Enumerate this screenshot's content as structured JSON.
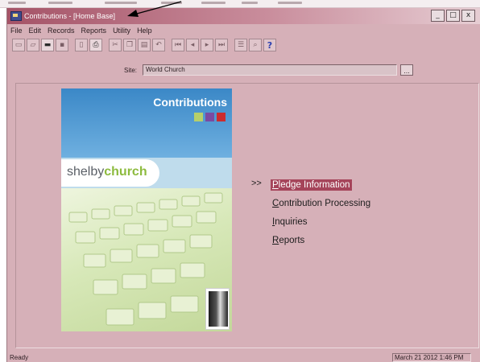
{
  "window": {
    "title": "Contributions - [Home Base]",
    "controls": {
      "minimize": "_",
      "maximize": "□",
      "close": "x"
    }
  },
  "menu": [
    "File",
    "Edit",
    "Records",
    "Reports",
    "Utility",
    "Help"
  ],
  "toolbar": {
    "icons": [
      "new-icon",
      "open-icon",
      "folder-icon",
      "save-icon",
      "page-icon",
      "print-icon",
      "cut-icon",
      "copy-icon",
      "paste-icon",
      "undo-icon",
      "first-record-icon",
      "previous-record-icon",
      "next-record-icon",
      "last-record-icon",
      "list-icon",
      "find-icon",
      "help-icon"
    ],
    "help_glyph": "?"
  },
  "site": {
    "label": "Site:",
    "value": "World Church",
    "browse_label": "..."
  },
  "splash": {
    "heading": "Contributions",
    "brand_prefix": "shelby",
    "brand_suffix": "church",
    "square_colors": [
      "#b6cf6a",
      "#7a4aa2",
      "#cc2c2e"
    ]
  },
  "options": {
    "marker": ">>",
    "items": [
      {
        "label": "Pledge Information",
        "selected": true
      },
      {
        "label": "Contribution Processing",
        "selected": false
      },
      {
        "label": "Inquiries",
        "selected": false
      },
      {
        "label": "Reports",
        "selected": false
      }
    ]
  },
  "status": {
    "left": "Ready",
    "right": "March 21 2012 1:46 PM"
  },
  "colors": {
    "window_bg": "#d6b0b8",
    "titlebar_start": "#a55367",
    "selection": "#a5445a",
    "banner_blue": "#3b88c7"
  }
}
